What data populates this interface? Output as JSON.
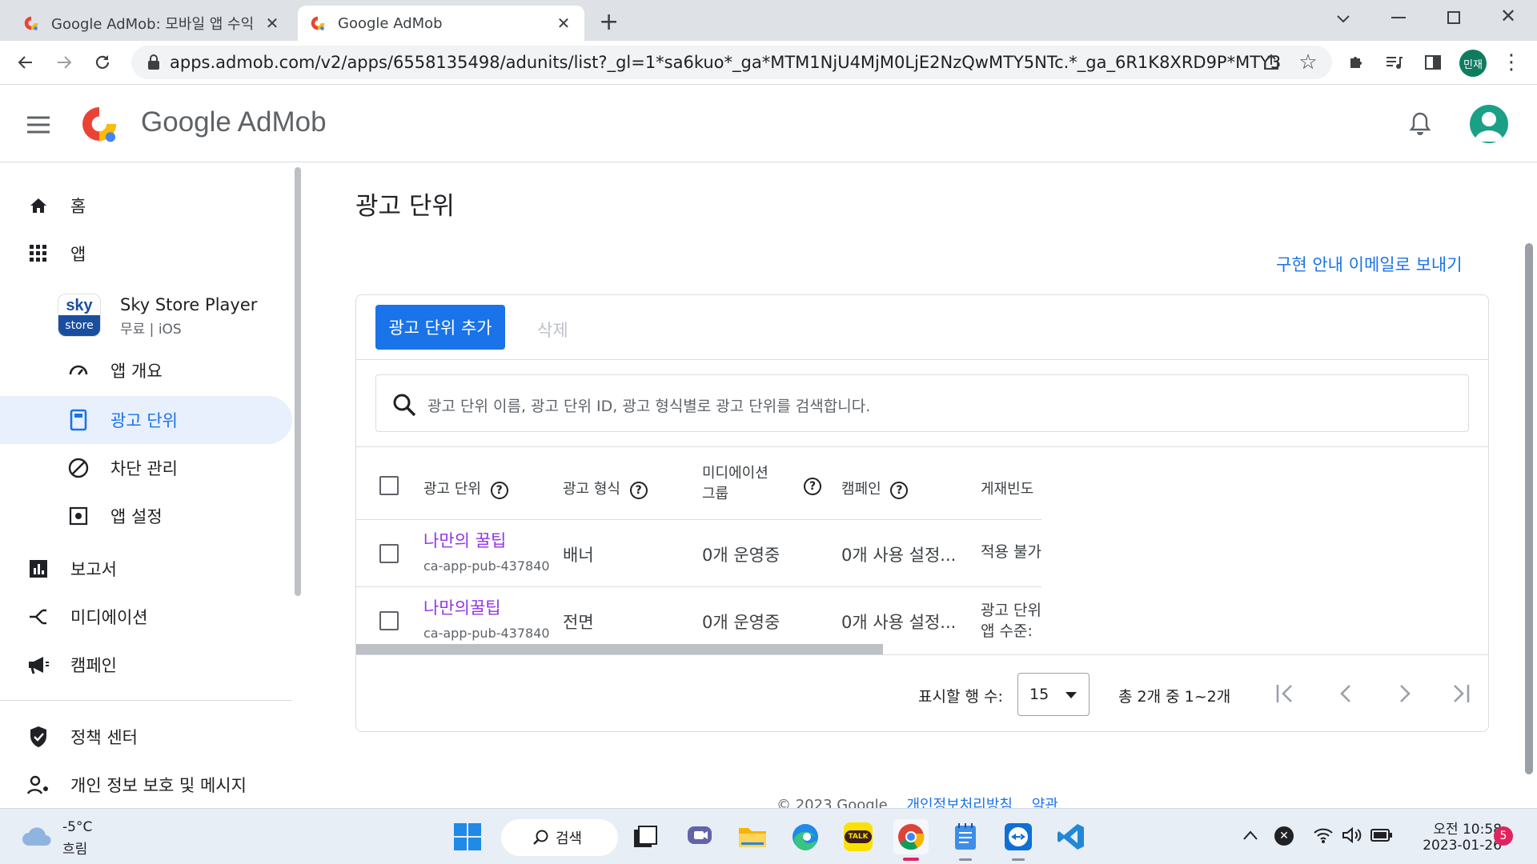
{
  "browser": {
    "tabs": [
      {
        "title": "Google AdMob: 모바일 앱 수익"
      },
      {
        "title": "Google AdMob"
      }
    ],
    "url": "apps.admob.com/v2/apps/6558135498/adunits/list?_gl=1*sa6kuo*_ga*MTM1NjU4MjM0LjE2NzQwMTY5NTc.*_ga_6R1K8XRD9P*MTY3NDY5...",
    "profile_label": "민재"
  },
  "header": {
    "brand": "Google AdMob"
  },
  "sidebar": {
    "home": "홈",
    "apps": "앱",
    "app": {
      "name": "Sky Store Player",
      "meta": "무료 | iOS",
      "logo_top": "sky",
      "logo_bottom": "store"
    },
    "app_overview": "앱 개요",
    "ad_units": "광고 단위",
    "blocking": "차단 관리",
    "app_settings": "앱 설정",
    "reports": "보고서",
    "mediation": "미디에이션",
    "campaigns": "캠페인",
    "policy_center": "정책 센터",
    "privacy": "개인 정보 보호 및 메시지"
  },
  "main": {
    "title": "광고 단위",
    "email_link": "구현 안내 이메일로 보내기",
    "add_button": "광고 단위 추가",
    "delete_button": "삭제",
    "search_placeholder": "광고 단위 이름, 광고 단위 ID, 광고 형식별로 광고 단위를 검색합니다.",
    "columns": {
      "ad_unit": "광고 단위",
      "format": "광고 형식",
      "mediation_line1": "미디에이션",
      "mediation_line2": "그룹",
      "campaign": "캠페인",
      "frequency": "게재빈도"
    },
    "rows": [
      {
        "name": "나만의 꿀팁",
        "id": "ca-app-pub-437840",
        "format": "배너",
        "mediation": "0개 운영중",
        "campaign": "0개 사용 설정...",
        "frequency_line1": "적용 불가",
        "frequency_line2": ""
      },
      {
        "name": "나만의꿀팁",
        "id": "ca-app-pub-437840",
        "format": "전면",
        "mediation": "0개 운영중",
        "campaign": "0개 사용 설정...",
        "frequency_line1": "광고 단위",
        "frequency_line2": "앱 수준:"
      }
    ],
    "pagination": {
      "rows_label": "표시할 행 수:",
      "rows_value": "15",
      "range": "총 2개 중 1~2개"
    },
    "footer": {
      "copyright": "© 2023 Google",
      "privacy": "개인정보처리방침",
      "terms": "약관"
    }
  },
  "taskbar": {
    "weather_temp": "-5°C",
    "weather_desc": "흐림",
    "search_label": "검색",
    "clock_time": "오전 10:58",
    "clock_date": "2023-01-26",
    "notification_count": "5",
    "kakao_label": "TALK"
  },
  "colors": {
    "accent": "#1a73e8",
    "link_visited": "#9334e6",
    "nav_active_bg": "#e8f0fe"
  }
}
